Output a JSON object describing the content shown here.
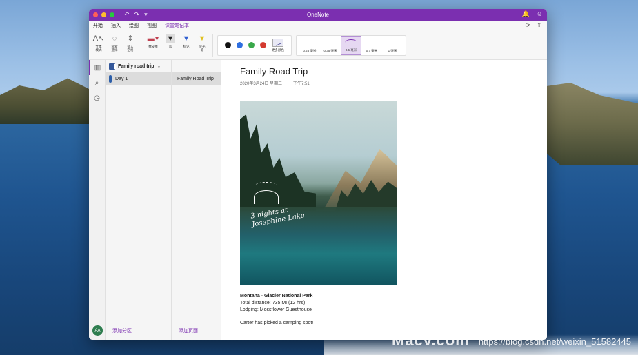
{
  "window": {
    "title": "OneNote"
  },
  "titlebar": {
    "undo_icon": "undo-icon",
    "redo_icon": "redo-icon",
    "quick_access_more": "▾",
    "right_icons": [
      "bell-icon",
      "smiley-icon"
    ]
  },
  "tabs": {
    "items": [
      {
        "label": "开始"
      },
      {
        "label": "插入"
      },
      {
        "label": "绘图"
      },
      {
        "label": "视图"
      },
      {
        "label": "课堂笔记本"
      }
    ],
    "active": "绘图",
    "right_icons": [
      "sync-icon",
      "share-icon"
    ]
  },
  "ribbon": {
    "tools": [
      {
        "label": "文本\n模式",
        "icon": "text-mode-icon"
      },
      {
        "label": "套索\n选择",
        "icon": "lasso-icon"
      },
      {
        "label": "插入\n空格",
        "icon": "insert-space-icon"
      }
    ],
    "pens": [
      {
        "label": "橡皮擦",
        "icon": "eraser-icon"
      },
      {
        "label": "笔",
        "icon": "pen-icon"
      },
      {
        "label": "标记",
        "icon": "marker-icon"
      },
      {
        "label": "荧光\n笔",
        "icon": "highlighter-icon"
      }
    ],
    "colors": [
      "#111111",
      "#2f6fe0",
      "#3aa84a",
      "#d43a2f"
    ],
    "more_colors_label": "更多颜色",
    "widths": [
      {
        "label": "0.25 毫米"
      },
      {
        "label": "0.35 毫米"
      },
      {
        "label": "0.5 毫米"
      },
      {
        "label": "0.7 毫米"
      },
      {
        "label": "1 毫米"
      }
    ],
    "selected_width": "0.5 毫米"
  },
  "navigation": {
    "rail": [
      "notebooks-icon",
      "search-icon",
      "recent-icon"
    ],
    "avatar_initials": "AA",
    "notebook_name": "Family road trip",
    "sections": [
      {
        "label": "Day 1",
        "color": "#2c5ea8"
      }
    ],
    "add_section_label": "添加分区",
    "pages": [
      {
        "label": "Family Road Trip"
      }
    ],
    "add_page_label": "添加页面"
  },
  "page": {
    "title": "Family Road Trip",
    "date": "2020年3月24日 星期二",
    "time": "下午7:51",
    "image_caption_script": "3 nights at\nJosephine Lake",
    "notes": {
      "heading": "Montana - Glacier National Park",
      "line1": "Total distance: 735 MI (12 hrs)",
      "line2": "Lodging: Mossflower Guesthouse",
      "line3": "Carter has picked a camping spot!"
    }
  },
  "overlay": {
    "watermark_url": "https://blog.csdn.net/weixin_51582445",
    "watermark_brand": "Macv.com"
  },
  "colors": {
    "accent": "#7b2fb0",
    "section_tab": "#2c5ea8"
  }
}
